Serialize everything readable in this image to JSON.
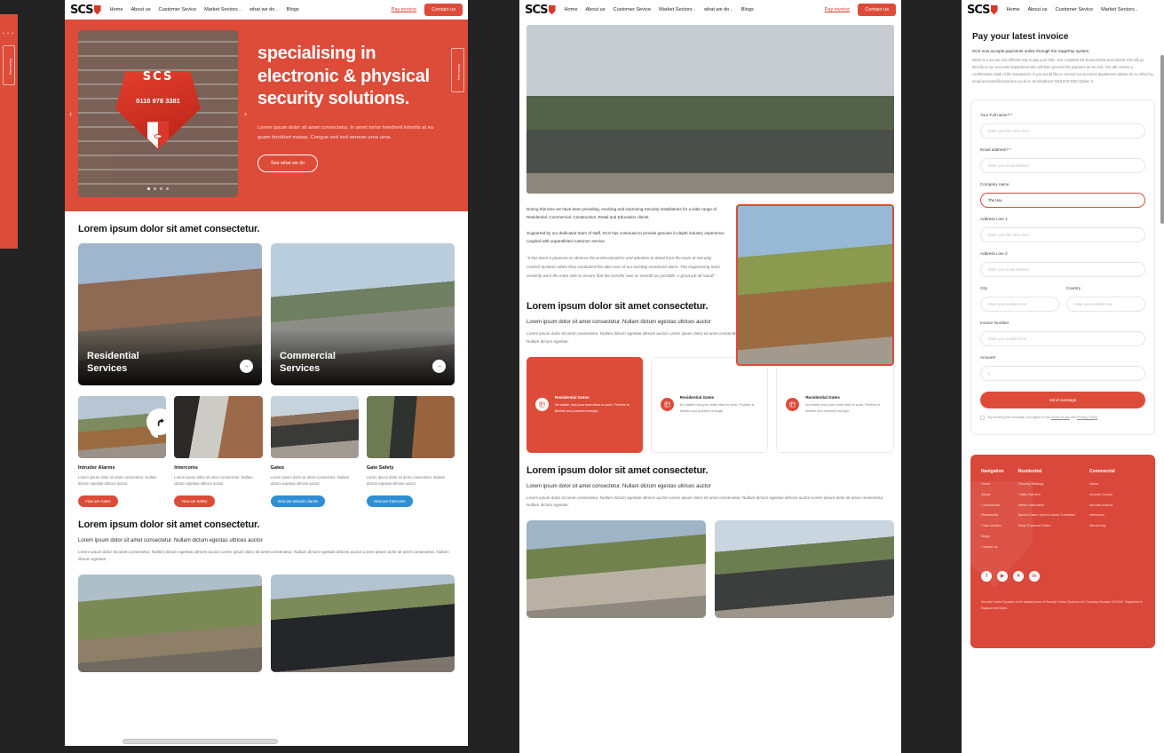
{
  "brand": {
    "name": "SCS",
    "accent": "#dd4b39",
    "dark": "#17181a"
  },
  "nav": {
    "logo_text": "SCS",
    "links": [
      {
        "label": "Home"
      },
      {
        "label": "About us"
      },
      {
        "label": "Customer Sevice"
      },
      {
        "label": "Market Sectors",
        "caret": "⌄"
      },
      {
        "label": "what we do",
        "caret": "⌄"
      },
      {
        "label": "Blogs"
      }
    ],
    "pay_invoice": "Pay invoice",
    "contact_cta": "Contact us"
  },
  "side_tab": {
    "label": "Free survey",
    "dots": "• • •"
  },
  "hero": {
    "heading": "specialising in electronic & physical security solutions.",
    "paragraph": "Lorem ipsum dolor sit amet consectetur. In amet tortor hendrerit lobortis at eu quam tincidunt massa. Congue sed sed aenean urna urna.",
    "cta": "See what we do",
    "siren_brand": "SCS",
    "siren_phone": "0118 978 3381",
    "prev_arrow": "‹",
    "next_arrow": "›"
  },
  "section_services": {
    "heading": "Lorem ipsum dolor sit amet consectetur.",
    "cards": [
      {
        "title_line1": "Residential",
        "title_line2": "Services",
        "arrow": "→"
      },
      {
        "title_line1": "Commercial",
        "title_line2": "Services",
        "arrow": "→"
      }
    ]
  },
  "products": [
    {
      "title": "Intruder Alarms",
      "desc": "Lorem ipsum dolor sit amet consectetur. Nullam dictum egestas ultrices auctor",
      "button": "View are Gates",
      "button_color": "#dd4b39"
    },
    {
      "title": "Intercoms",
      "desc": "Lorem ipsum dolor sit amet consectetur. Nullam dictum egestas ultrices auctor",
      "button": "View are Safety",
      "button_color": "#dd4b39"
    },
    {
      "title": "Gates",
      "desc": "Lorem ipsum dolor sit amet consectetur. Nullam dictum egestas ultrices auctor",
      "button": "View are Intruder Alarms",
      "button_color": "#2f8fd4"
    },
    {
      "title": "Gate Safety",
      "desc": "Lorem ipsum dolor sit amet consectetur. Nullam dictum egestas ultrices auctor",
      "button": "View are Intercoms",
      "button_color": "#2f8fd4"
    }
  ],
  "section_generic": {
    "heading": "Lorem ipsum dolor sit amet consectetur.",
    "lead": "Lorem ipsum dolor sit amet consectetur. Nullam dictum egestas ultrices auctor",
    "body": "Lorem ipsum dolor sit amet consectetur. Nullam dictum egestas ultrices auctor Lorem ipsum dolor sit amet consectetur. Nullam dictum egestas ultrices auctor Lorem ipsum dolor sit amet consectetur. Nullam dictum egestas."
  },
  "about": {
    "para1": "During this time we have been providing, evolving and improving Security Installations for a wide range of Residential, Commercial, Construction, Retail and Education clients.",
    "para2": "Supported by our dedicated team of staff, SCS has continued to provide genuine in-depth industry experience coupled with unparalleled customer service.",
    "quote": "“It has been a pleasure to observe the professionalism and attention to detail from the team at Security Control Systems when they conducted the take over of our existing monitored alarm. The engineering team certainly went the extra mile to ensure that the transfer was as smooth as possible. A great job all round”"
  },
  "feature_cards": [
    {
      "title": "Residential Gates",
      "desc": "No matter how your team likes to work. Fineline is flexible and powerful enough.",
      "active": true
    },
    {
      "title": "Residential Gates",
      "desc": "No matter how your team likes to work. Fineline is flexible and powerful enough.",
      "active": false
    },
    {
      "title": "Residential Gates",
      "desc": "No matter how your team likes to work. Fineline is flexible and powerful enough.",
      "active": false
    }
  ],
  "invoice": {
    "heading": "Pay your latest invoice",
    "lead": "SCS now accepts payments online through the SagePay system,",
    "body": "which is a secure and efficient way to pay your bills. Just complete the boxes below and submit, this will go directly to our accounts department who will then process the payment at our end. You will receive a confirmation email of the transaction. If you would like to contact our accounts department please do so either by email accounts@scssecure.co.uk or via telephone 0118 978 3381 Option 3.",
    "fields": [
      {
        "label": "Your Full name? *",
        "placeholder": "Enter your full name here",
        "value": ""
      },
      {
        "label": "Email address? *",
        "placeholder": "Enter your email address",
        "value": ""
      },
      {
        "label": "Company name",
        "placeholder": "",
        "value": "The Hou",
        "focused": true
      },
      {
        "label": "Address Line 1",
        "placeholder": "Enter your full name here",
        "value": ""
      },
      {
        "label": "Address Line 2",
        "placeholder": "Enter your email address",
        "value": ""
      },
      {
        "label": "City",
        "placeholder": "Enter your number here",
        "value": ""
      },
      {
        "label": "Country",
        "placeholder": "Enter your number here",
        "value": ""
      },
      {
        "label": "Invoice Number",
        "placeholder": "Enter your number here",
        "value": ""
      },
      {
        "label": "Amount*",
        "placeholder": "£",
        "value": ""
      }
    ],
    "submit": "Send message",
    "agree_prefix": "By sending this message, you agree to the ",
    "terms": "Terms of use",
    "agree_mid": " and ",
    "privacy": "Privacy Policy"
  },
  "footer": {
    "columns": [
      {
        "heading": "Navigation",
        "links": [
          "Home",
          "About",
          "Commercial",
          "Residential",
          "Case studies",
          "Blogs",
          "Contact us"
        ]
      },
      {
        "heading": "Residential",
        "links": [
          "Fencing Railings",
          "Traffic Barriers",
          "Metal Fabrication",
          "Speed Gates Speed Lanes Turnstiles",
          "Solar Powered Gates"
        ]
      },
      {
        "heading": "Commercial",
        "links": [
          "Alarm",
          "Access Control",
          "Intruder Alarms",
          "Intercoms",
          "Monitoring"
        ]
      }
    ],
    "socials": [
      "f",
      "▶",
      "✕",
      "in"
    ],
    "legal": "Security Control Systems is the trading name of Security Control Systems Ltd. Company Number 1021402. Registered in England and Wales."
  }
}
